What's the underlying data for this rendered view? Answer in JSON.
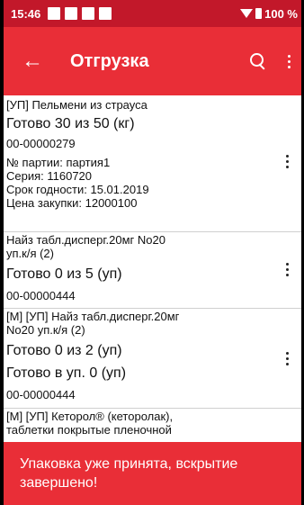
{
  "status_bar": {
    "time": "15:46",
    "battery": "100 %"
  },
  "app_bar": {
    "title": "Отгрузка"
  },
  "items": [
    {
      "header": "[УП] Пельмени из страуса",
      "ready": "Готово 30 из 50 (кг)",
      "code": "00-00000279",
      "batch": "№ партии: партия1",
      "series": "Серия: 1160720",
      "expiry": "Срок годности: 15.01.2019",
      "price": "Цена закупки: 12000100"
    },
    {
      "header_lines": [
        "Найз табл.дисперг.20мг No20",
        "уп.к/я (2)"
      ],
      "ready": "Готово 0 из 5 (уп)",
      "code": "00-00000444"
    },
    {
      "header_lines": [
        "[М] [УП] Найз табл.дисперг.20мг",
        "No20 уп.к/я (2)"
      ],
      "ready": "Готово 0 из 2 (уп)",
      "ready_packs": "Готово в уп. 0 (уп)",
      "code": "00-00000444"
    },
    {
      "header_lines": [
        "[М] [УП] Кеторол® (кеторолак),",
        "таблетки покрытые пленочной"
      ]
    }
  ],
  "toast": {
    "lines": [
      "Упаковка уже принята, вскрытие",
      "завершено!"
    ]
  }
}
